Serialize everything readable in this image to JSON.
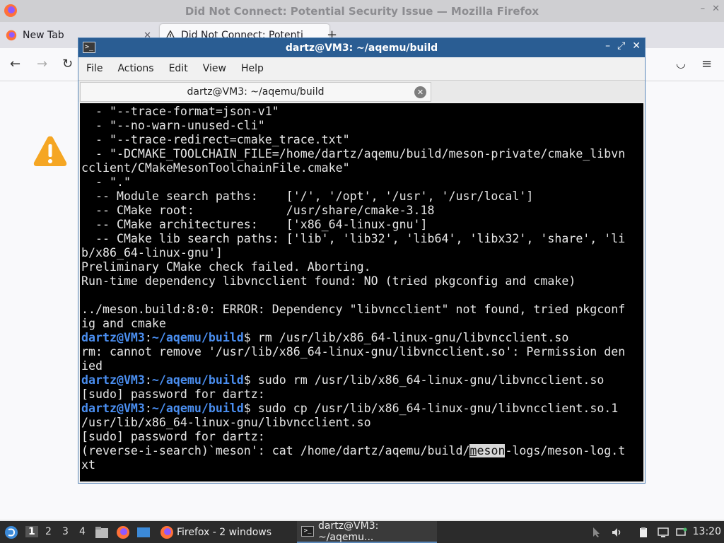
{
  "firefox": {
    "window_title": "Did Not Connect: Potential Security Issue — Mozilla Firefox",
    "tabs": [
      {
        "label": "New Tab",
        "icon": "firefox-icon"
      },
      {
        "label": "Did Not Connect: Potenti",
        "icon": "warning-icon"
      }
    ],
    "window_buttons": [
      "–",
      "✕"
    ]
  },
  "terminal": {
    "window_title": "dartz@VM3: ~/aqemu/build",
    "menu": [
      "File",
      "Actions",
      "Edit",
      "View",
      "Help"
    ],
    "tab_label": "dartz@VM3: ~/aqemu/build",
    "prompt_user": "dartz@VM3",
    "prompt_path": "~/aqemu/build",
    "lines": [
      "  - \"--trace-format=json-v1\"",
      "  - \"--no-warn-unused-cli\"",
      "  - \"--trace-redirect=cmake_trace.txt\"",
      "  - \"-DCMAKE_TOOLCHAIN_FILE=/home/dartz/aqemu/build/meson-private/cmake_libvn",
      "cclient/CMakeMesonToolchainFile.cmake\"",
      "  - \".\"",
      "  -- Module search paths:    ['/', '/opt', '/usr', '/usr/local']",
      "  -- CMake root:             /usr/share/cmake-3.18",
      "  -- CMake architectures:    ['x86_64-linux-gnu']",
      "  -- CMake lib search paths: ['lib', 'lib32', 'lib64', 'libx32', 'share', 'li",
      "b/x86_64-linux-gnu']",
      "Preliminary CMake check failed. Aborting.",
      "Run-time dependency libvncclient found: NO (tried pkgconfig and cmake)",
      "",
      "../meson.build:8:0: ERROR: Dependency \"libvncclient\" not found, tried pkgconf",
      "ig and cmake"
    ],
    "cmd1": "rm /usr/lib/x86_64-linux-gnu/libvncclient.so",
    "out1a": "rm: cannot remove '/usr/lib/x86_64-linux-gnu/libvncclient.so': Permission den",
    "out1b": "ied",
    "cmd2": "sudo rm /usr/lib/x86_64-linux-gnu/libvncclient.so",
    "out2": "[sudo] password for dartz:",
    "cmd3": "sudo cp /usr/lib/x86_64-linux-gnu/libvncclient.so.1",
    "cmd3b": "/usr/lib/x86_64-linux-gnu/libvncclient.so",
    "out3": "[sudo] password for dartz:",
    "search_prefix": "(reverse-i-search)`meson': cat /home/dartz/aqemu/build/",
    "search_cursor_char": "m",
    "search_match_rest": "eson",
    "search_suffix": "-logs/meson-log.t",
    "search_wrap": "xt"
  },
  "taskbar": {
    "workspaces": [
      "1",
      "2",
      "3",
      "4"
    ],
    "tasks": [
      {
        "label": "Firefox - 2 windows",
        "icon": "firefox-icon"
      },
      {
        "label": "dartz@VM3: ~/aqemu...",
        "icon": "terminal-icon"
      }
    ],
    "clock": "13:20"
  },
  "colors": {
    "terminal_title_bg": "#2a5d93",
    "prompt_blue": "#4a8ef0",
    "warning_orange": "#f5a623"
  }
}
